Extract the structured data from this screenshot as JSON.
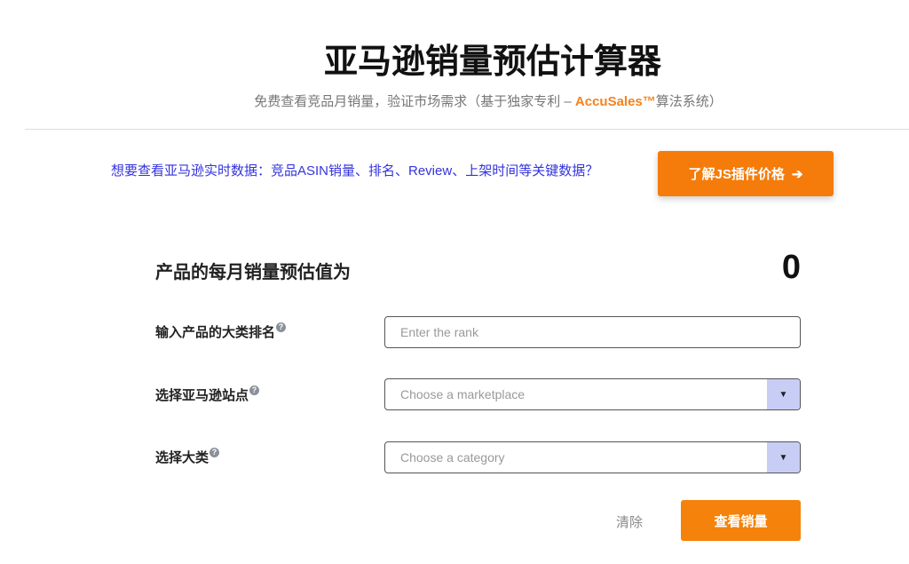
{
  "header": {
    "title": "亚马逊销量预估计算器",
    "subtitle_prefix": "免费查看竞品月销量，验证市场需求（基于独家专利 – ",
    "subtitle_brand": "AccuSales™",
    "subtitle_suffix": "算法系统）"
  },
  "promo": {
    "text": "想要查看亚马逊实时数据：竞品ASIN销量、排名、Review、上架时间等关键数据？",
    "button_label": "了解JS插件价格",
    "button_icon": "arrow-right-icon"
  },
  "result": {
    "label": "产品的每月销量预估值为",
    "value": "0"
  },
  "form": {
    "rank": {
      "label": "输入产品的大类排名",
      "placeholder": "Enter the rank",
      "value": ""
    },
    "marketplace": {
      "label": "选择亚马逊站点",
      "placeholder": "Choose a marketplace"
    },
    "category": {
      "label": "选择大类",
      "placeholder": "Choose a category"
    },
    "help_glyph": "?",
    "clear_label": "清除",
    "submit_label": "查看销量"
  },
  "colors": {
    "accent": "#f57c0a",
    "promo_text": "#3333dd",
    "dropdown_caret_bg": "#c8cdf5"
  }
}
